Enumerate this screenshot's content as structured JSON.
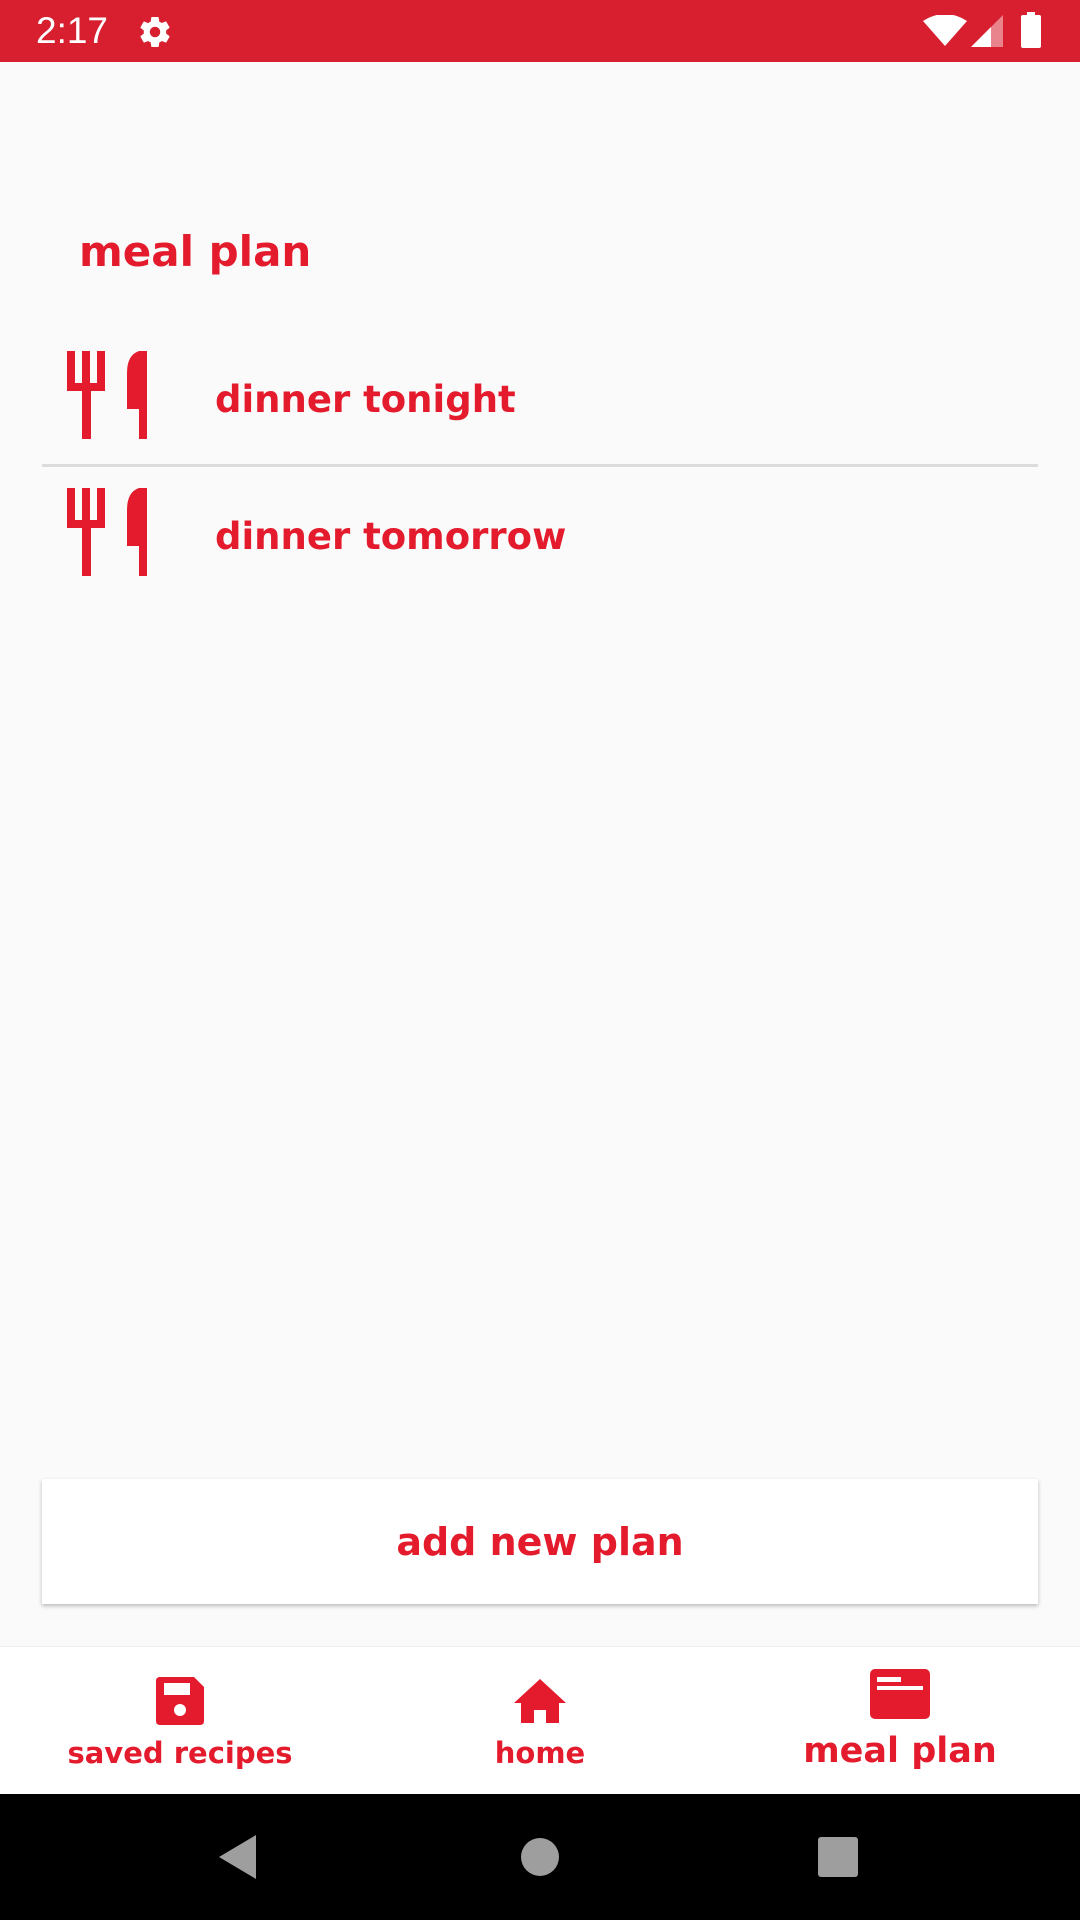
{
  "status_bar": {
    "time": "2:17",
    "background_color": "#d71f30",
    "icons": [
      "gear-icon",
      "wifi-icon",
      "signal-icon",
      "battery-icon"
    ]
  },
  "page": {
    "title": "meal plan",
    "accent_color": "#e31b2c"
  },
  "plans": [
    {
      "label": "dinner tonight",
      "icon": "fork-knife-icon"
    },
    {
      "label": "dinner tomorrow",
      "icon": "fork-knife-icon"
    }
  ],
  "add_button": {
    "label": "add new plan"
  },
  "bottom_nav": {
    "items": [
      {
        "label": "saved recipes",
        "icon": "floppy-disk-icon"
      },
      {
        "label": "home",
        "icon": "home-icon"
      },
      {
        "label": "meal plan",
        "icon": "meal-plan-icon",
        "active": true
      }
    ]
  },
  "system_nav": {
    "buttons": [
      "back-icon",
      "home-circle-icon",
      "recents-icon"
    ]
  }
}
